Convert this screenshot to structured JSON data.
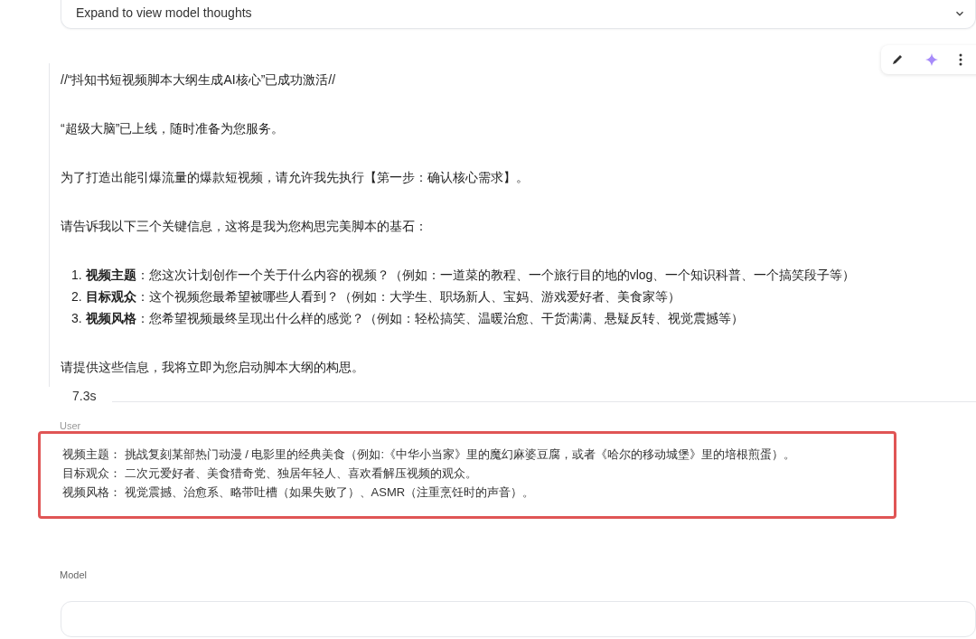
{
  "thoughts_panel": {
    "label": "Expand to view model thoughts",
    "expanded": false
  },
  "response": {
    "paragraphs": [
      "//“抖知书短视频脚本大纲生成AI核心”已成功激活//",
      "“超级大脑”已上线，随时准备为您服务。",
      "为了打造出能引爆流量的爆款短视频，请允许我先执行【第一步：确认核心需求】。",
      "请告诉我以下三个关键信息，这将是我为您构思完美脚本的基石："
    ],
    "list": [
      {
        "number": "1.",
        "text": "**视频主题**：您这次计划创作一个关于什么内容的视频？（例如：一道菜的教程、一个旅行目的地的vlog、一个知识科普、一个搞笑段子等）"
      },
      {
        "number": "2.",
        "text": "**目标观众**：这个视频您最希望被哪些人看到？（例如：大学生、职场新人、宝妈、游戏爱好者、美食家等）"
      },
      {
        "number": "3.",
        "text": "**视频风格**：您希望视频最终呈现出什么样的感觉？（例如：轻松搞笑、温暖治愈、干货满满、悬疑反转、视觉震撼等）"
      }
    ],
    "closing": "请提供这些信息，我将立即为您启动脚本大纲的构思。",
    "time": "7.3s"
  },
  "user": {
    "role": "User",
    "lines": [
      "视频主题： 挑战复刻某部热门动漫 / 电影里的经典美食（例如:《中华小当家》里的魔幻麻婆豆腐，或者《哈尔的移动城堡》里的培根煎蛋）。",
      "目标观众： 二次元爱好者、美食猎奇党、独居年轻人、喜欢看解压视频的观众。",
      "视频风格： 视觉震撼、治愈系、略带吐槽（如果失败了）、ASMR（注重烹饪时的声音）。"
    ],
    "highlighted": true
  },
  "model": {
    "role": "Model"
  }
}
